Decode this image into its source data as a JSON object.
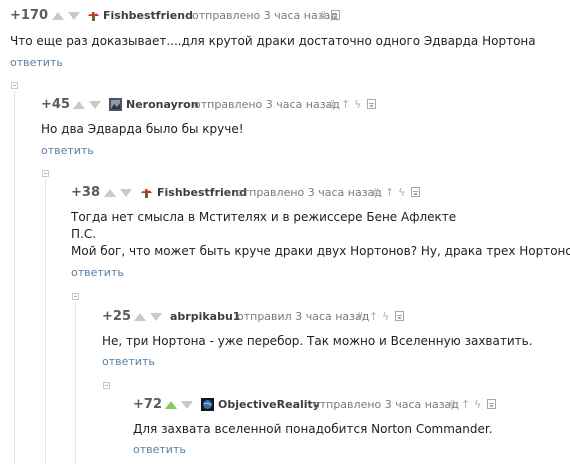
{
  "comments": [
    {
      "score": "+170",
      "author": "Fishbestfriend",
      "avatar_icon": "mushroom-icon",
      "meta": "отправлено 3 часа назад",
      "text_lines": [
        "Что еще раз доказывает....для крутой драки достаточно одного Эдварда Нортона"
      ],
      "reply": "ответить",
      "upvoted": false
    },
    {
      "score": "+45",
      "author": "Neronayron",
      "avatar_icon": "photo-avatar-icon",
      "meta": "отправлено 3 часа назад",
      "text_lines": [
        "Но два Эдварда было бы круче!"
      ],
      "reply": "ответить",
      "upvoted": false
    },
    {
      "score": "+38",
      "author": "Fishbestfriend",
      "avatar_icon": "mushroom-icon",
      "meta": "отправлено 3 часа назад",
      "text_lines": [
        "Тогда нет смысла в Мстителях и в режиссере Бене Афлекте",
        "П.С.",
        "Мой бог, что может быть круче драки двух Нортонов? Ну, драка трех Нортонов)"
      ],
      "reply": "ответить",
      "upvoted": false
    },
    {
      "score": "+25",
      "author": "abrpikabu1",
      "avatar_icon": "none",
      "meta": "отправил 3 часа назад",
      "text_lines": [
        "Не, три Нортона - уже перебор. Так можно и Вселенную захватить."
      ],
      "reply": "ответить",
      "upvoted": false
    },
    {
      "score": "+72",
      "author": "ObjectiveReality",
      "avatar_icon": "planet-avatar-icon",
      "meta": "отправлено 3 часа назад",
      "text_lines": [
        "Для захвата вселенной понадобится Norton Commander."
      ],
      "reply": "ответить",
      "upvoted": true
    }
  ],
  "tools": {
    "hash": "#",
    "up": "↑",
    "branch": "ϟ"
  },
  "colors": {
    "upvote_active": "#8ac858",
    "vote_inactive": "#c9c9c9",
    "reply_link": "#5a7fa8",
    "mushroom_cap": "#c0392b"
  }
}
